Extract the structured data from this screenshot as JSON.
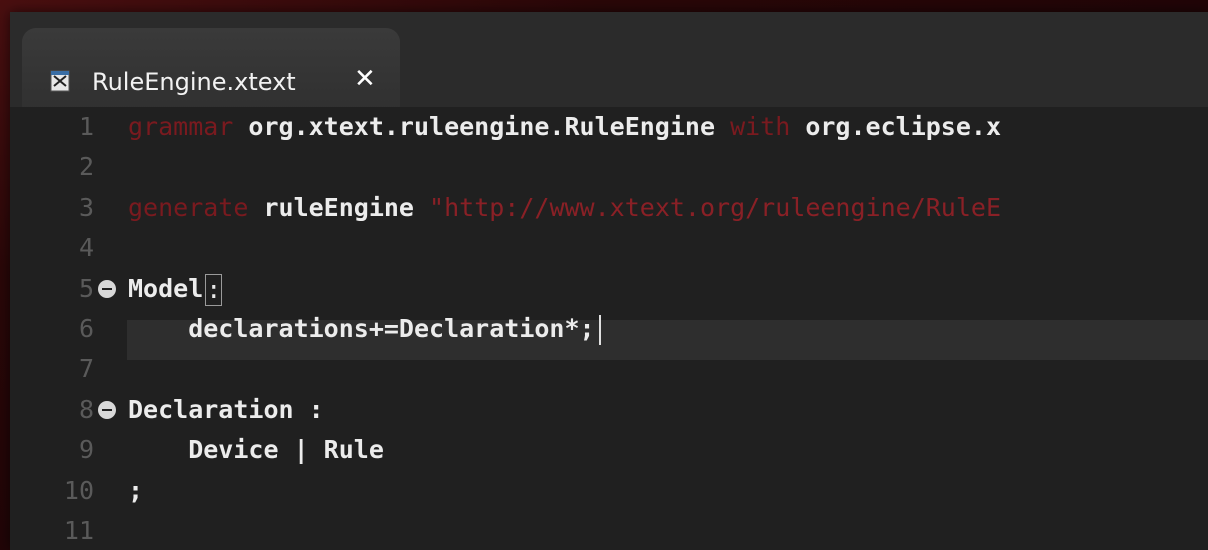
{
  "tab": {
    "title": "RuleEngine.xtext",
    "close_glyph": "✕"
  },
  "lines": [
    {
      "num": "1",
      "parts": [
        {
          "t": "grammar",
          "c": "kw"
        },
        {
          "t": " org.xtext.ruleengine.RuleEngine ",
          "c": "id"
        },
        {
          "t": "with",
          "c": "kw"
        },
        {
          "t": " org.eclipse.x",
          "c": "id"
        }
      ]
    },
    {
      "num": "2",
      "parts": []
    },
    {
      "num": "3",
      "parts": [
        {
          "t": "generate",
          "c": "kw"
        },
        {
          "t": " ruleEngine ",
          "c": "id"
        },
        {
          "t": "\"http://www.xtext.org/ruleengine/RuleE",
          "c": "str"
        }
      ]
    },
    {
      "num": "4",
      "parts": []
    },
    {
      "num": "5",
      "fold": true,
      "parts": [
        {
          "t": "Model",
          "c": "id"
        }
      ],
      "box": ":"
    },
    {
      "num": "6",
      "current": true,
      "parts": [
        {
          "t": "    declarations+=Declaration*;",
          "c": "id"
        }
      ],
      "caret": true
    },
    {
      "num": "7",
      "parts": []
    },
    {
      "num": "8",
      "fold": true,
      "parts": [
        {
          "t": "Declaration :",
          "c": "id"
        }
      ]
    },
    {
      "num": "9",
      "parts": [
        {
          "t": "    Device | Rule",
          "c": "id"
        }
      ]
    },
    {
      "num": "10",
      "parts": [
        {
          "t": ";",
          "c": "id"
        }
      ]
    },
    {
      "num": "11",
      "parts": []
    }
  ],
  "colors": {
    "keyword": "#7a1a1f",
    "string": "#8a2026",
    "identifier": "#ececec",
    "line_number": "#5a5a5a",
    "editor_bg": "#202020"
  }
}
